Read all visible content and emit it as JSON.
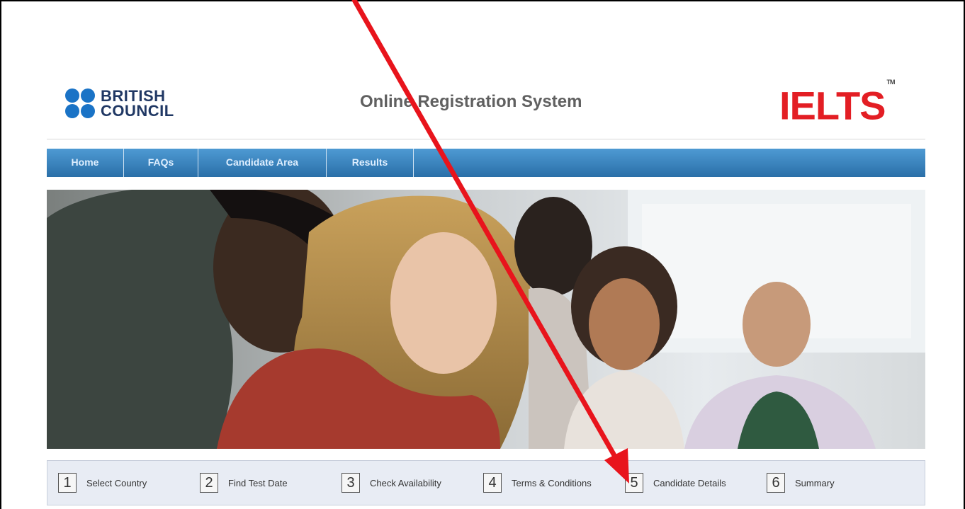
{
  "header": {
    "brand_line1": "BRITISH",
    "brand_line2": "COUNCIL",
    "title": "Online Registration System",
    "ielts_logo": "IELTS",
    "ielts_tm": "TM"
  },
  "nav": {
    "items": [
      {
        "label": "Home"
      },
      {
        "label": "FAQs"
      },
      {
        "label": "Candidate Area"
      },
      {
        "label": "Results"
      }
    ]
  },
  "steps": [
    {
      "num": "1",
      "label": "Select Country"
    },
    {
      "num": "2",
      "label": "Find Test Date"
    },
    {
      "num": "3",
      "label": "Check Availability"
    },
    {
      "num": "4",
      "label": "Terms & Conditions"
    },
    {
      "num": "5",
      "label": "Candidate Details"
    },
    {
      "num": "6",
      "label": "Summary"
    }
  ],
  "colors": {
    "accent": "#2a6fa8",
    "ielts_red": "#e31e24",
    "brand_blue": "#1a73c6",
    "annotation_arrow": "#e8141c"
  }
}
